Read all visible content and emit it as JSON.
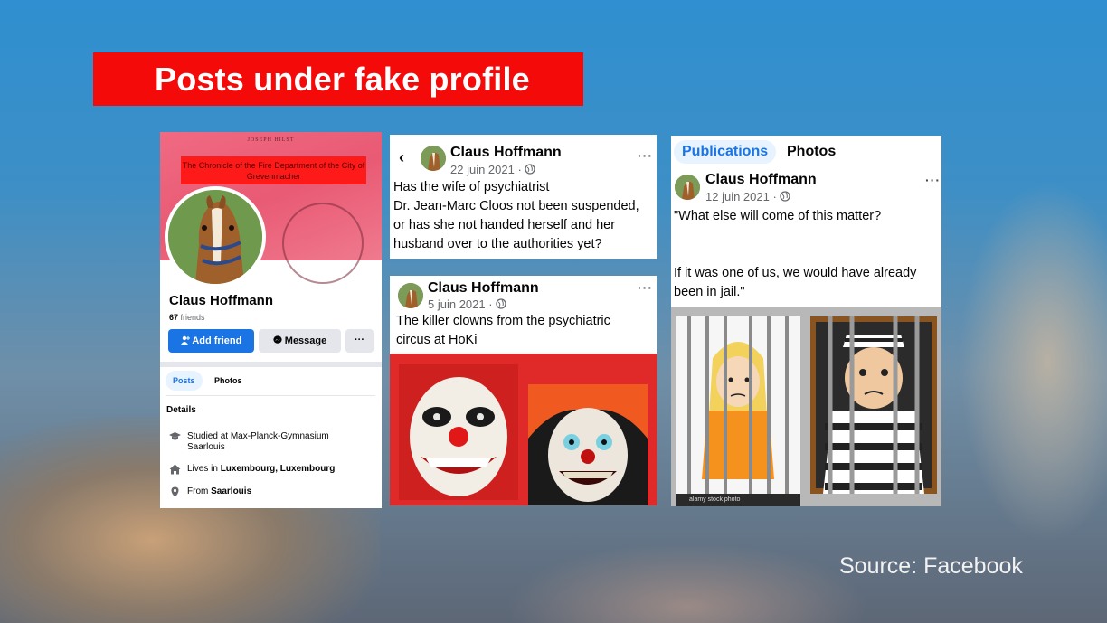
{
  "title": "Posts under fake profile",
  "source": "Source: Facebook",
  "profile": {
    "cover_small_text": "JOSEPH HILST",
    "cover_caption": "The Chronicle of the Fire Department of the City of Grevenmacher",
    "name": "Claus Hoffmann",
    "friends_count": "67",
    "friends_label": "friends",
    "add_friend": "Add friend",
    "message": "Message",
    "more": "···",
    "tabs": [
      "Posts",
      "Photos"
    ],
    "details_title": "Details",
    "details": [
      {
        "icon": "graduation-cap-icon",
        "text": "Studied at Max-Planck-Gymnasium Saarlouis"
      },
      {
        "icon": "home-icon",
        "prefix": "Lives in ",
        "bold": "Luxembourg, Luxembourg"
      },
      {
        "icon": "location-pin-icon",
        "prefix": "From ",
        "bold": "Saarlouis"
      }
    ]
  },
  "post1": {
    "author": "Claus Hoffmann",
    "date": "22 juin 2021 · ",
    "text": "Has the wife of psychiatrist\nDr. Jean-Marc Cloos not been suspended,\n or has she not handed herself and her\nhusband over to the authorities yet?"
  },
  "post2": {
    "author": "Claus Hoffmann",
    "date": "5 juin 2021 · ",
    "text": "The killer clowns from the psychiatric\ncircus at HoKi"
  },
  "post3": {
    "tabs": [
      "Publications",
      "Photos"
    ],
    "author": "Claus Hoffmann",
    "date": "12 juin 2021 · ",
    "text": "\"What else will come of this matter?\n\n\nIf it was one of us, we would have already\nbeen in jail.\"",
    "stock_label": "alamy stock photo"
  },
  "colors": {
    "banner": "#f50a0a",
    "facebook_blue": "#1b74e4"
  }
}
